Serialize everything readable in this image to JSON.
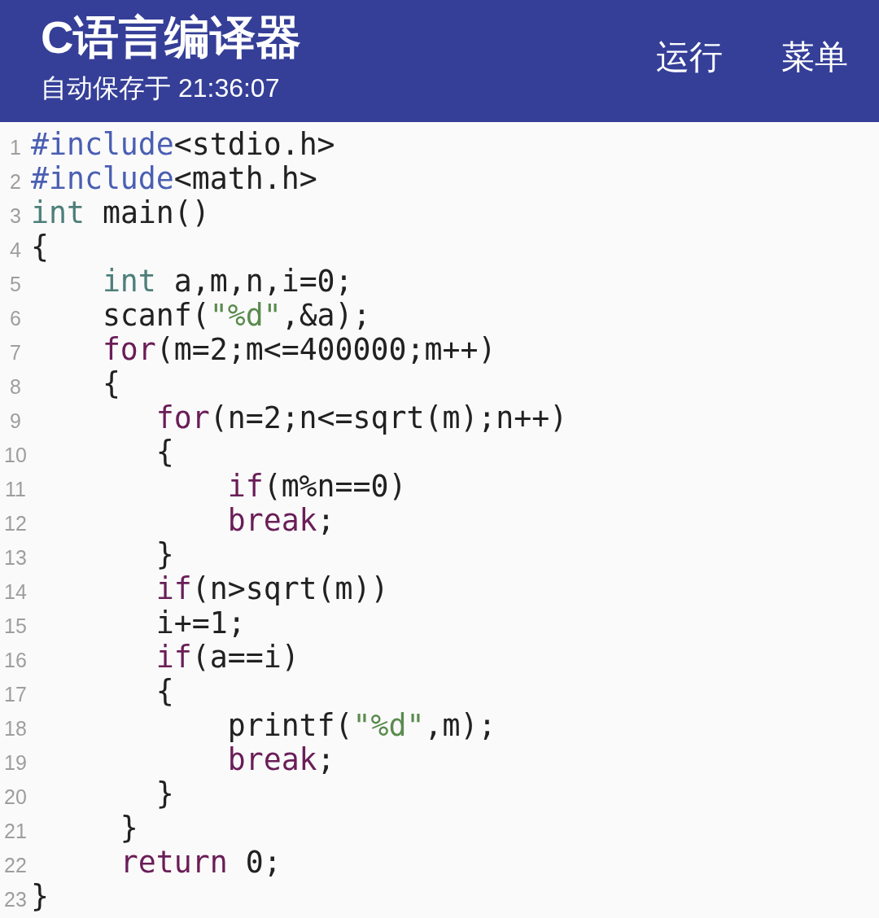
{
  "app_bar": {
    "title": "C语言编译器",
    "subtitle": "自动保存于 21:36:07",
    "actions": [
      {
        "label": "运行"
      },
      {
        "label": "菜单"
      }
    ]
  },
  "editor": {
    "lines": [
      {
        "number": "1",
        "tokens": [
          {
            "kind": "directive",
            "text": "#include"
          },
          {
            "kind": "plain",
            "text": "<stdio.h>"
          }
        ]
      },
      {
        "number": "2",
        "tokens": [
          {
            "kind": "directive",
            "text": "#include"
          },
          {
            "kind": "plain",
            "text": "<math.h>"
          }
        ]
      },
      {
        "number": "3",
        "tokens": [
          {
            "kind": "type",
            "text": "int"
          },
          {
            "kind": "plain",
            "text": " main()"
          }
        ]
      },
      {
        "number": "4",
        "tokens": [
          {
            "kind": "plain",
            "text": "{"
          }
        ]
      },
      {
        "number": "5",
        "tokens": [
          {
            "kind": "type",
            "text": "    int"
          },
          {
            "kind": "plain",
            "text": " a,m,n,i=0;"
          }
        ]
      },
      {
        "number": "6",
        "tokens": [
          {
            "kind": "plain",
            "text": "    scanf("
          },
          {
            "kind": "string",
            "text": "\"%d\""
          },
          {
            "kind": "plain",
            "text": ",&a);"
          }
        ]
      },
      {
        "number": "7",
        "tokens": [
          {
            "kind": "keyword",
            "text": "    for"
          },
          {
            "kind": "plain",
            "text": "(m=2;m<=400000;m++)"
          }
        ]
      },
      {
        "number": "8",
        "tokens": [
          {
            "kind": "plain",
            "text": "    {"
          }
        ]
      },
      {
        "number": "9",
        "tokens": [
          {
            "kind": "keyword",
            "text": "       for"
          },
          {
            "kind": "plain",
            "text": "(n=2;n<=sqrt(m);n++)"
          }
        ]
      },
      {
        "number": "10",
        "tokens": [
          {
            "kind": "plain",
            "text": "       {"
          }
        ]
      },
      {
        "number": "11",
        "tokens": [
          {
            "kind": "keyword",
            "text": "           if"
          },
          {
            "kind": "plain",
            "text": "(m%n==0)"
          }
        ]
      },
      {
        "number": "12",
        "tokens": [
          {
            "kind": "keyword",
            "text": "           break"
          },
          {
            "kind": "plain",
            "text": ";"
          }
        ]
      },
      {
        "number": "13",
        "tokens": [
          {
            "kind": "plain",
            "text": "       }"
          }
        ]
      },
      {
        "number": "14",
        "tokens": [
          {
            "kind": "keyword",
            "text": "       if"
          },
          {
            "kind": "plain",
            "text": "(n>sqrt(m))"
          }
        ]
      },
      {
        "number": "15",
        "tokens": [
          {
            "kind": "plain",
            "text": "       i+=1;"
          }
        ]
      },
      {
        "number": "16",
        "tokens": [
          {
            "kind": "keyword",
            "text": "       if"
          },
          {
            "kind": "plain",
            "text": "(a==i)"
          }
        ]
      },
      {
        "number": "17",
        "tokens": [
          {
            "kind": "plain",
            "text": "       {"
          }
        ]
      },
      {
        "number": "18",
        "tokens": [
          {
            "kind": "plain",
            "text": "           printf("
          },
          {
            "kind": "string",
            "text": "\"%d\""
          },
          {
            "kind": "plain",
            "text": ",m);"
          }
        ]
      },
      {
        "number": "19",
        "tokens": [
          {
            "kind": "keyword",
            "text": "           break"
          },
          {
            "kind": "plain",
            "text": ";"
          }
        ]
      },
      {
        "number": "20",
        "tokens": [
          {
            "kind": "plain",
            "text": "       }"
          }
        ]
      },
      {
        "number": "21",
        "tokens": [
          {
            "kind": "plain",
            "text": "     }"
          }
        ]
      },
      {
        "number": "22",
        "tokens": [
          {
            "kind": "keyword",
            "text": "     return"
          },
          {
            "kind": "plain",
            "text": " 0;"
          }
        ]
      },
      {
        "number": "23",
        "tokens": [
          {
            "kind": "plain",
            "text": "}"
          }
        ]
      }
    ]
  }
}
